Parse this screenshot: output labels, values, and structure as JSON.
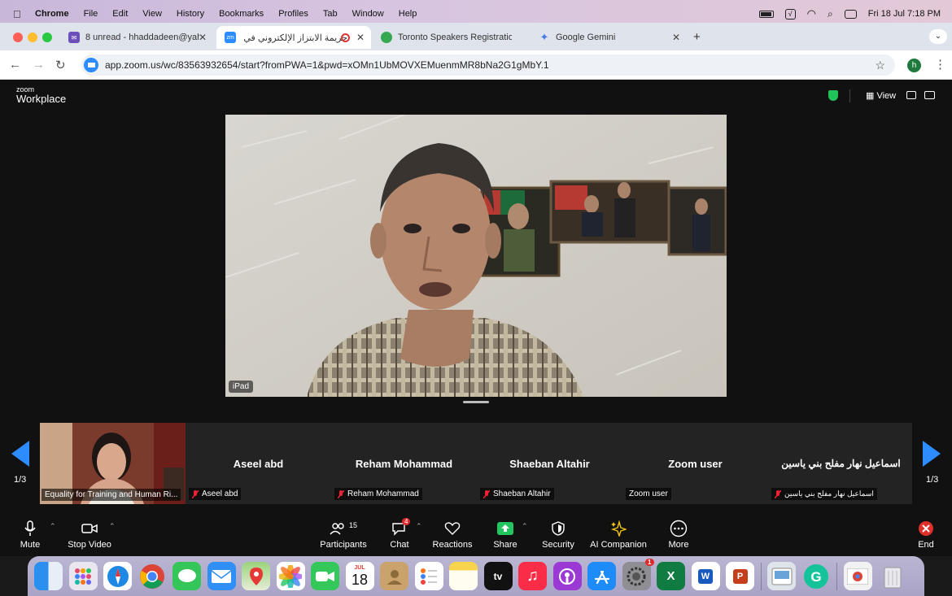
{
  "menubar": {
    "app_name": "Chrome",
    "items": [
      "File",
      "Edit",
      "View",
      "History",
      "Bookmarks",
      "Profiles",
      "Tab",
      "Window",
      "Help"
    ],
    "clock": "Fri 18 Jul  7:18 PM"
  },
  "tabs": [
    {
      "label": "8 unread - hhaddadeen@yah",
      "favicon": "mail-icon"
    },
    {
      "label": "جريمة الابتزاز الإلكتروني في القا",
      "favicon": "zoom-icon",
      "active": true
    },
    {
      "label": "Toronto Speakers Registration",
      "favicon": "form-icon"
    },
    {
      "label": "Google Gemini",
      "favicon": "gemini-icon"
    }
  ],
  "address": {
    "url": "app.zoom.us/wc/83563932654/start?fromPWA=1&pwd=xOMn1UbMOVXEMuenmMR8bNa2G1gMbY.1",
    "profile_initial": "h"
  },
  "zoom": {
    "logo_small": "zoom",
    "logo_big": "Workplace",
    "view_label": "View",
    "main_video_label": "iPad",
    "page_left": "1/3",
    "page_right": "1/3",
    "participants": [
      {
        "display": "",
        "tag": "Equality for Training and Human Ri...",
        "has_video": true
      },
      {
        "display": "Aseel abd",
        "tag": "Aseel abd",
        "muted": true
      },
      {
        "display": "Reham Mohammad",
        "tag": "Reham Mohammad",
        "muted": true
      },
      {
        "display": "Shaeban Altahir",
        "tag": "Shaeban Altahir",
        "muted": true
      },
      {
        "display": "Zoom user",
        "tag": "Zoom user",
        "muted": false
      },
      {
        "display": "اسماعيل نهار مفلح بني ياسين",
        "tag": "اسماعيل نهار مفلح بني ياسين",
        "muted": true
      }
    ],
    "toolbar": {
      "mute": "Mute",
      "stop_video": "Stop Video",
      "participants": "Participants",
      "participants_count": "15",
      "chat": "Chat",
      "chat_badge": "4",
      "reactions": "Reactions",
      "share": "Share",
      "security": "Security",
      "ai_companion": "AI Companion",
      "more": "More",
      "end": "End"
    }
  },
  "dock": {
    "calendar_month": "JUL",
    "calendar_day": "18",
    "tv_label": "tv",
    "settings_badge": "1"
  },
  "colors": {
    "zoom_blue": "#2d8cff",
    "share_green": "#22c55e",
    "end_red": "#e0302a"
  }
}
